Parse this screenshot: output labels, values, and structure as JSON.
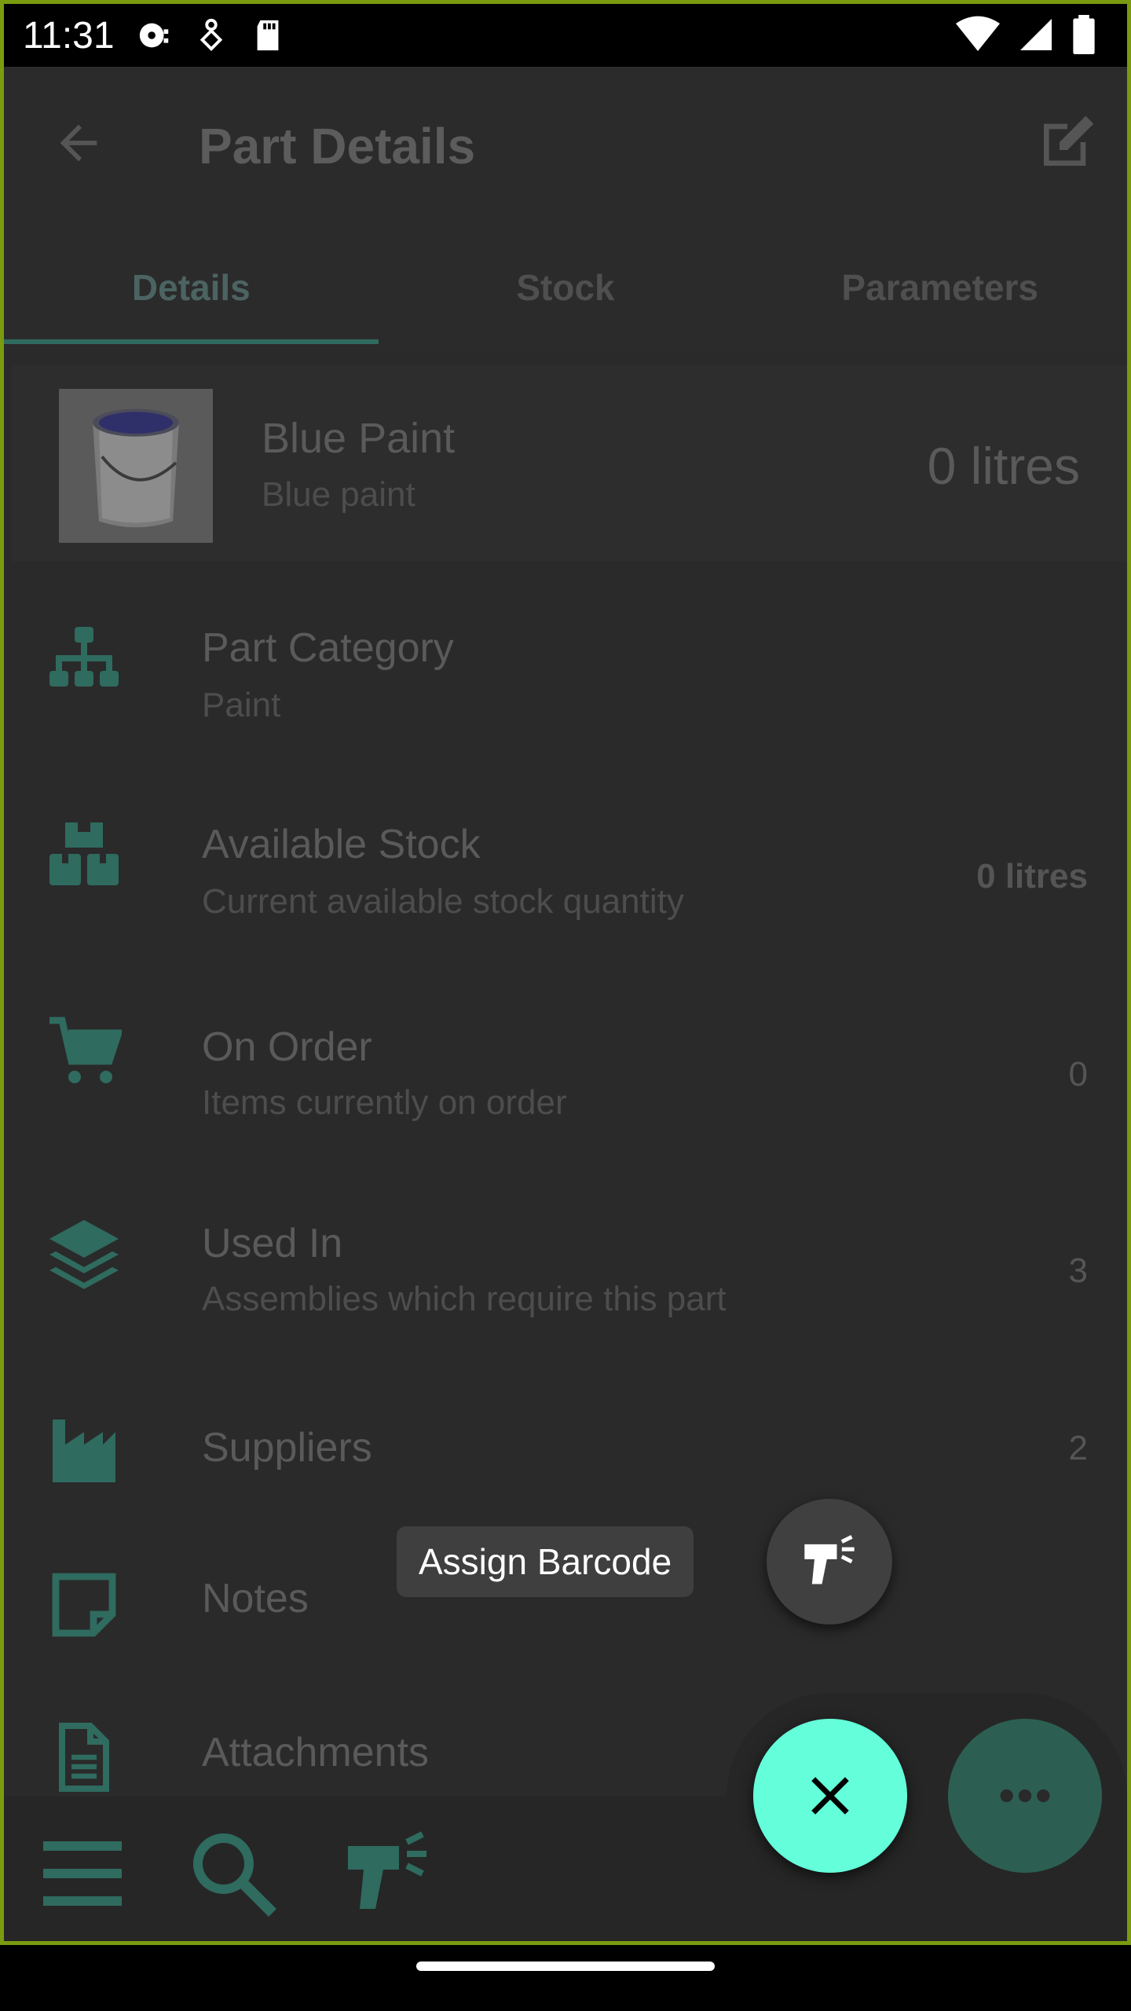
{
  "status_bar": {
    "time": "11:31"
  },
  "app_bar": {
    "title": "Part Details"
  },
  "tabs": [
    {
      "label": "Details",
      "active": true
    },
    {
      "label": "Stock",
      "active": false
    },
    {
      "label": "Parameters",
      "active": false
    }
  ],
  "part": {
    "name": "Blue Paint",
    "description": "Blue paint",
    "quantity": "0 litres"
  },
  "rows": [
    {
      "icon": "sitemap-icon",
      "title": "Part Category",
      "subtitle": "Paint",
      "value": ""
    },
    {
      "icon": "boxes-icon",
      "title": "Available Stock",
      "subtitle": "Current available stock quantity",
      "value": "0 litres"
    },
    {
      "icon": "cart-icon",
      "title": "On Order",
      "subtitle": "Items currently on order",
      "value": "0"
    },
    {
      "icon": "layers-icon",
      "title": "Used In",
      "subtitle": "Assemblies which require this part",
      "value": "3"
    },
    {
      "icon": "industry-icon",
      "title": "Suppliers",
      "subtitle": "",
      "value": "2"
    },
    {
      "icon": "note-icon",
      "title": "Notes",
      "subtitle": "",
      "value": ""
    },
    {
      "icon": "file-icon",
      "title": "Attachments",
      "subtitle": "",
      "value": ""
    }
  ],
  "speed_dial": {
    "tooltip": "Assign Barcode"
  },
  "colors": {
    "accent": "#64ffda",
    "icon_green": "#2f6b5f",
    "background": "#2a2a2a"
  }
}
